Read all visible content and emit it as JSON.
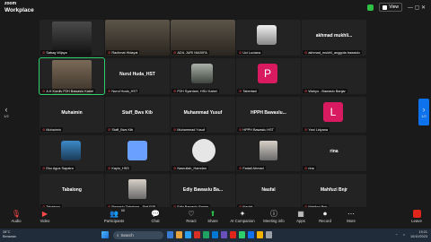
{
  "app": {
    "brand_line1": "zoom",
    "brand_line2": "Workplace"
  },
  "header": {
    "view_label": "View",
    "window_controls": "—  ▢  ✕"
  },
  "pager": {
    "left": "1/2",
    "right": "1/2"
  },
  "tiles": [
    {
      "caption": "Sabag Wijaya",
      "type": "photo-dark"
    },
    {
      "caption": "Rachmat Hidayat",
      "type": "photo-wide"
    },
    {
      "caption": "ADIL JURI NIASIFA",
      "type": "photo-wide"
    },
    {
      "caption": "Uci Luciana",
      "type": "photo-hijab"
    },
    {
      "caption": "akhmad_mukhli_anggota bawaslu",
      "center": "akhmad mukhli...",
      "type": "name"
    },
    {
      "caption": "A.K Kordiv P2H Bawaslu Kabel",
      "type": "photo",
      "active": true
    },
    {
      "caption": "Nurul Huda_HST",
      "center": "Nurul Huda_HST",
      "type": "name"
    },
    {
      "caption": "P2H Syardani, HSU Kabel",
      "type": "photo-avatar"
    },
    {
      "caption": "Tabertani",
      "type": "letter",
      "letter": "P",
      "color": "#d81b60"
    },
    {
      "caption": "Wahyu - Bawaslu Banjar",
      "type": "empty"
    },
    {
      "caption": "Muhaimin",
      "center": "Muhaimin",
      "type": "name"
    },
    {
      "caption": "Staff_Bws Ktb",
      "center": "Staff_Bws Ktb",
      "type": "name"
    },
    {
      "caption": "Muhammad Yusuf",
      "center": "Muhammad Yusuf",
      "type": "name"
    },
    {
      "caption": "HPPH Bawaslu HST",
      "center": "HPPH Bawaslu...",
      "type": "name"
    },
    {
      "caption": "Yani Lidyana",
      "type": "letter",
      "letter": "L",
      "color": "#d81b60"
    },
    {
      "caption": "Eko Agus Sapatra",
      "type": "photo-person"
    },
    {
      "caption": "Kaylo_HSS",
      "type": "photo-blue"
    },
    {
      "caption": "Nasrullah_Hamdan",
      "type": "photo-sketch"
    },
    {
      "caption": "Fadall Ahmad",
      "type": "photo-small"
    },
    {
      "caption": "rina",
      "center": "rina",
      "type": "name"
    },
    {
      "caption": "Tabalong",
      "center": "Tabalong",
      "type": "name"
    },
    {
      "caption": "Bawaslu Tabalong - Staf P3S",
      "type": "photo-small"
    },
    {
      "caption": "Edly Bawaslu Banjar",
      "center": "Edly Bawaslu Ba...",
      "type": "name"
    },
    {
      "caption": "Naufal",
      "center": "Naufal",
      "type": "name"
    },
    {
      "caption": "Mahfuzi Bnjr",
      "center": "Mahfuzi Bnjr",
      "type": "name"
    }
  ],
  "toolbar": [
    {
      "label": "Audio",
      "icon": "mic-muted-icon",
      "glyph": "🎙",
      "red": true
    },
    {
      "label": "Video",
      "icon": "video-off-icon",
      "glyph": "▶",
      "red": true
    },
    {
      "label": "Participants",
      "icon": "participants-icon",
      "glyph": "👥",
      "badge": "66"
    },
    {
      "label": "Chat",
      "icon": "chat-icon",
      "glyph": "💬"
    },
    {
      "label": "React",
      "icon": "react-icon",
      "glyph": "♡"
    },
    {
      "label": "Share",
      "icon": "share-icon",
      "glyph": "⬆",
      "green": true
    },
    {
      "label": "AI Companion",
      "icon": "ai-companion-icon",
      "glyph": "✦"
    },
    {
      "label": "Meeting info",
      "icon": "meeting-info-icon",
      "glyph": "ⓘ"
    },
    {
      "label": "Apps",
      "icon": "apps-icon",
      "glyph": "▦"
    },
    {
      "label": "Record",
      "icon": "record-icon",
      "glyph": "⏺"
    },
    {
      "label": "More",
      "icon": "more-icon",
      "glyph": "⋯"
    },
    {
      "label": "Leave",
      "icon": "leave-icon",
      "glyph": ""
    }
  ],
  "taskbar": {
    "weather_temp": "28°C",
    "weather_desc": "Berawan",
    "search_placeholder": "Search",
    "time": "19:21",
    "date": "10/10/2023",
    "icon_colors": [
      "#3a7bd5",
      "#e6a23c",
      "#2aa1f0",
      "#d93025",
      "#1ea362",
      "#0078d4",
      "#6b4fbb",
      "#e0261a",
      "#2dd06a",
      "#0e72ed",
      "#f4b400",
      "#9aa0a6"
    ]
  }
}
